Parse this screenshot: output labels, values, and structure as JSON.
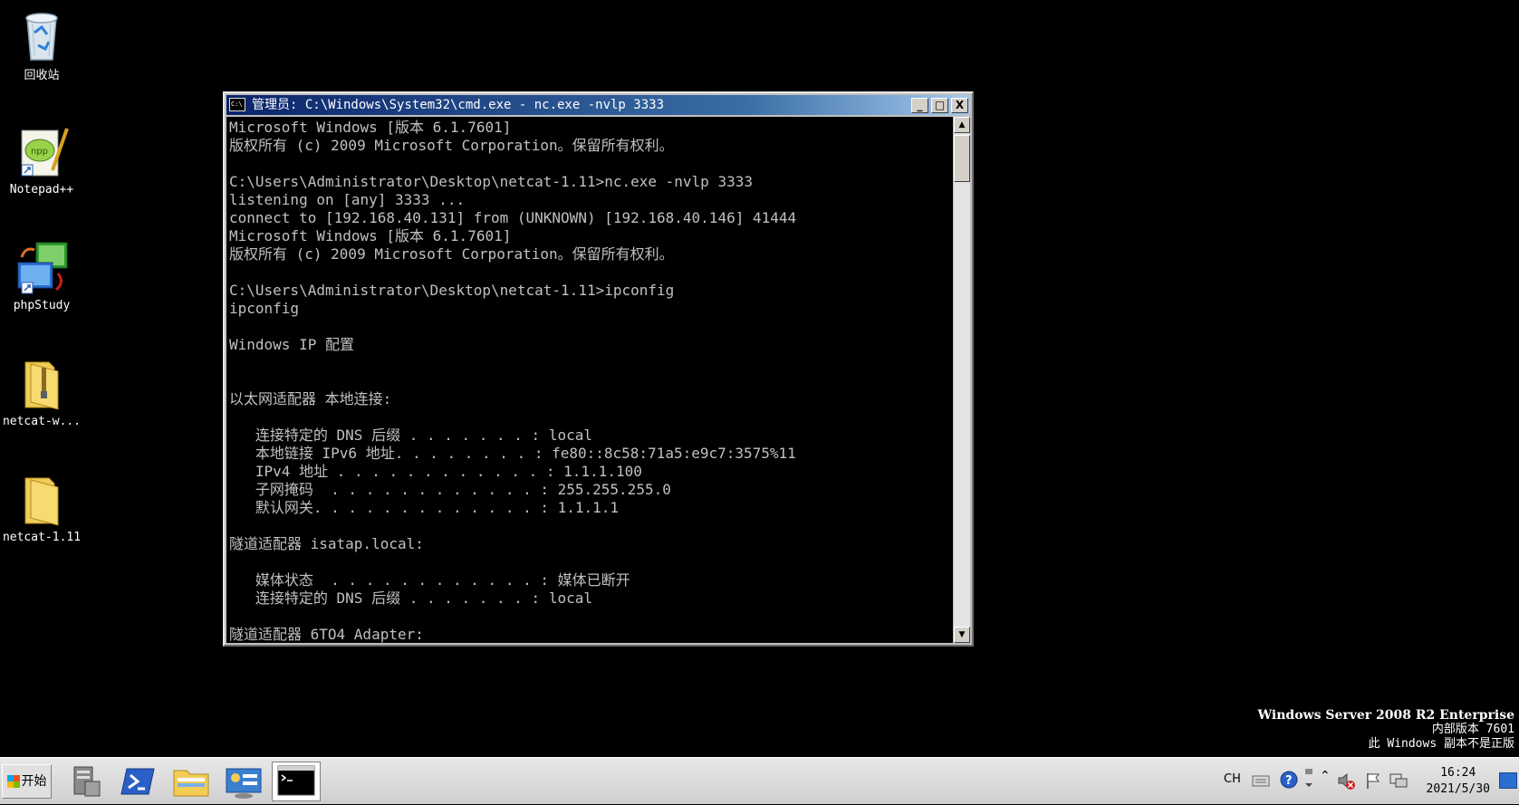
{
  "desktop": {
    "icons": [
      {
        "label": "回收站",
        "icon": "recycle-bin-icon"
      },
      {
        "label": "Notepad++",
        "icon": "notepadplusplus-icon"
      },
      {
        "label": "phpStudy",
        "icon": "phpstudy-icon"
      },
      {
        "label": "netcat-w...",
        "icon": "zip-folder-icon"
      },
      {
        "label": "netcat-1.11",
        "icon": "folder-icon"
      }
    ]
  },
  "cmd_window": {
    "title": "管理员: C:\\Windows\\System32\\cmd.exe - nc.exe  -nvlp 3333",
    "app_icon_text": "C:\\",
    "minimize_label": "_",
    "maximize_label": "□",
    "close_label": "X",
    "scroll_up_label": "▲",
    "scroll_down_label": "▼",
    "output": "Microsoft Windows [版本 6.1.7601]\n版权所有 (c) 2009 Microsoft Corporation。保留所有权利。\n\nC:\\Users\\Administrator\\Desktop\\netcat-1.11>nc.exe -nvlp 3333\nlistening on [any] 3333 ...\nconnect to [192.168.40.131] from (UNKNOWN) [192.168.40.146] 41444\nMicrosoft Windows [版本 6.1.7601]\n版权所有 (c) 2009 Microsoft Corporation。保留所有权利。\n\nC:\\Users\\Administrator\\Desktop\\netcat-1.11>ipconfig\nipconfig\n\nWindows IP 配置\n\n\n以太网适配器 本地连接:\n\n   连接特定的 DNS 后缀 . . . . . . . : local\n   本地链接 IPv6 地址. . . . . . . . : fe80::8c58:71a5:e9c7:3575%11\n   IPv4 地址 . . . . . . . . . . . . : 1.1.1.100\n   子网掩码  . . . . . . . . . . . . : 255.255.255.0\n   默认网关. . . . . . . . . . . . . : 1.1.1.1\n\n隧道适配器 isatap.local:\n\n   媒体状态  . . . . . . . . . . . . : 媒体已断开\n   连接特定的 DNS 后缀 . . . . . . . : local\n\n隧道适配器 6TO4 Adapter:"
  },
  "watermark": {
    "line1": "Windows Server 2008 R2 Enterprise",
    "line2": "内部版本 7601",
    "line3": "此 Windows 副本不是正版"
  },
  "taskbar": {
    "start_label": "开始",
    "items": [
      {
        "icon": "server-manager-icon"
      },
      {
        "icon": "powershell-icon"
      },
      {
        "icon": "explorer-icon"
      },
      {
        "icon": "control-panel-icon"
      },
      {
        "icon": "cmd-icon",
        "active": true
      }
    ],
    "tray": {
      "language": "CH",
      "clock_time": "16:24",
      "clock_date": "2021/5/30"
    }
  },
  "colors": {
    "desktop_bg": "#000000",
    "titlebar_start": "#0a246a",
    "titlebar_end": "#a6caf0",
    "console_text": "#c0c0c0",
    "console_bg": "#000000"
  }
}
